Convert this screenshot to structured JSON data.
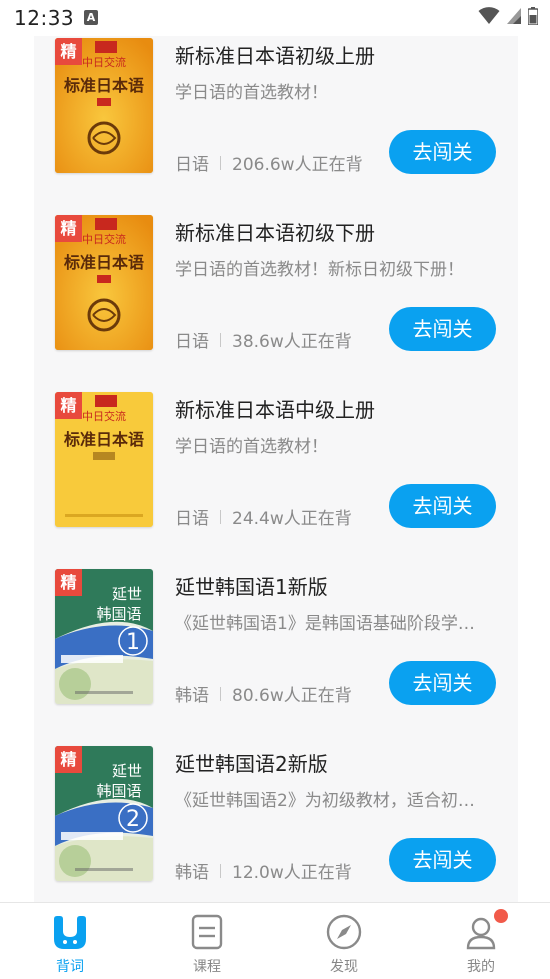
{
  "status": {
    "time": "12:33",
    "a_icon": "A"
  },
  "books": [
    {
      "badge": "精",
      "title": "新标准日本语初级上册",
      "desc": "学日语的首选教材！",
      "lang": "日语",
      "learners": "206.6w人正在背",
      "button": "去闯关",
      "cover": "jp-orange"
    },
    {
      "badge": "精",
      "title": "新标准日本语初级下册",
      "desc": "学日语的首选教材！新标日初级下册！",
      "lang": "日语",
      "learners": "38.6w人正在背",
      "button": "去闯关",
      "cover": "jp-orange"
    },
    {
      "badge": "精",
      "title": "新标准日本语中级上册",
      "desc": "学日语的首选教材！",
      "lang": "日语",
      "learners": "24.4w人正在背",
      "button": "去闯关",
      "cover": "jp-yellow"
    },
    {
      "badge": "精",
      "title": "延世韩国语1新版",
      "desc": "《延世韩国语1》是韩国语基础阶段学…",
      "lang": "韩语",
      "learners": "80.6w人正在背",
      "button": "去闯关",
      "cover": "kr-1"
    },
    {
      "badge": "精",
      "title": "延世韩国语2新版",
      "desc": "《延世韩国语2》为初级教材，适合初…",
      "lang": "韩语",
      "learners": "12.0w人正在背",
      "button": "去闯关",
      "cover": "kr-2"
    }
  ],
  "tabs": [
    {
      "label": "背词",
      "icon": "beici-icon",
      "active": true
    },
    {
      "label": "课程",
      "icon": "course-icon",
      "active": false
    },
    {
      "label": "发现",
      "icon": "compass-icon",
      "active": false
    },
    {
      "label": "我的",
      "icon": "profile-icon",
      "active": false,
      "badge": true
    }
  ],
  "colors": {
    "accent": "#0aa1f0",
    "badge": "#e84a3d",
    "background_card": "#f7f7f8"
  }
}
